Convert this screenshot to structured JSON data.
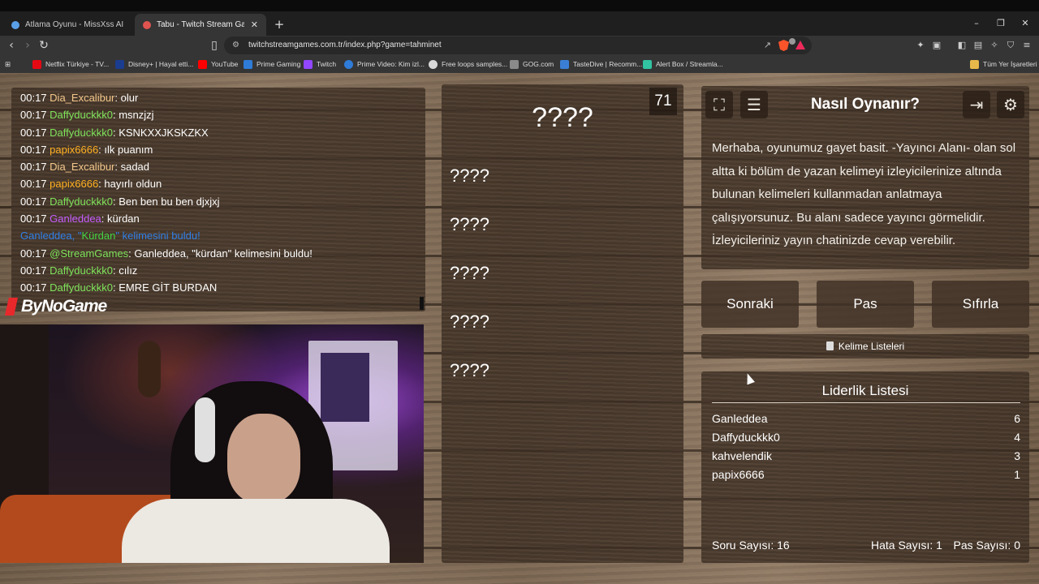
{
  "browser": {
    "tabs": [
      {
        "title": "Atlama Oyunu - MissXss AI Bot Syste",
        "active": false,
        "color": "#5aa0e8"
      },
      {
        "title": "Tabu - Twitch Stream Games",
        "active": true,
        "color": "#e0544f"
      }
    ],
    "new_tab": "+",
    "window_controls": {
      "minimize": "–",
      "maximize": "❐",
      "close": "✕"
    },
    "url": "twitchstreamgames.com.tr/index.php?game=tahminet",
    "bookmarks": [
      {
        "label": "Netflix Türkiye - TV...",
        "color": "#e50914"
      },
      {
        "label": "Disney+ | Hayal etti...",
        "color": "#1a3d8f"
      },
      {
        "label": "YouTube",
        "color": "#ff0000"
      },
      {
        "label": "Prime Gaming",
        "color": "#2f7bd8"
      },
      {
        "label": "Twitch",
        "color": "#9146ff"
      },
      {
        "label": "Prime Video: Kim izl...",
        "color": "#2f7bd8"
      },
      {
        "label": "Free loops samples...",
        "color": "#d9d9d9"
      },
      {
        "label": "GOG.com",
        "color": "#8a8a8a"
      },
      {
        "label": "TasteDive | Recomm...",
        "color": "#3a7fd5"
      },
      {
        "label": "Alert Box / Streamla...",
        "color": "#31c3a2"
      }
    ],
    "all_bookmarks": "Tüm Yer İşaretleri"
  },
  "chat": {
    "lines": [
      {
        "time": "00:17",
        "user": "Dia_Excalibur",
        "user_color": "#f3c78a",
        "msg": ": olur"
      },
      {
        "time": "00:17",
        "user": "Daffyduckkk0",
        "user_color": "#7fe35b",
        "msg": ": msnzjzj"
      },
      {
        "time": "00:17",
        "user": "Daffyduckkk0",
        "user_color": "#7fe35b",
        "msg": ": KSNKXXJKSKZKX"
      },
      {
        "time": "00:17",
        "user": "papix6666",
        "user_color": "#ffb020",
        "msg": ": ılk puanım"
      },
      {
        "time": "00:17",
        "user": "Dia_Excalibur",
        "user_color": "#f3c78a",
        "msg": ": sadad"
      },
      {
        "time": "00:17",
        "user": "papix6666",
        "user_color": "#ffb020",
        "msg": ": hayırlı oldun"
      },
      {
        "time": "00:17",
        "user": "Daffyduckkk0",
        "user_color": "#7fe35b",
        "msg": ": Ben ben bu ben djxjxj"
      },
      {
        "time": "00:17",
        "user": "Ganleddea",
        "user_color": "#c65cff",
        "msg": ": kürdan"
      },
      {
        "time": "",
        "user": "",
        "user_color": "#2f7fe8",
        "msg": ""
      },
      {
        "time": "00:17",
        "user": "@StreamGames",
        "user_color": "#7fe35b",
        "msg": ": Ganleddea, \"kürdan\" kelimesini buldu!"
      },
      {
        "time": "00:17",
        "user": "Daffyduckkk0",
        "user_color": "#7fe35b",
        "msg": ": cılız"
      },
      {
        "time": "00:17",
        "user": "Daffyduckkk0",
        "user_color": "#7fe35b",
        "msg": ": EMRE GİT BURDAN"
      }
    ],
    "announce": {
      "pre": "Ganleddea, \"",
      "word": "Kürdan",
      "post": "\" kelimesini buldu!",
      "color": "#2f7fe8",
      "word_color": "#42d442"
    }
  },
  "overlay_logo": "ByNoGame",
  "game": {
    "timer": "71",
    "main_word": "????",
    "taboo_words": [
      "????",
      "????",
      "????",
      "????",
      "????"
    ]
  },
  "how_to": {
    "title": "Nasıl Oynanır?",
    "body": "Merhaba, oyunumuz gayet basit. -Yayıncı Alanı- olan sol altta ki bölüm de yazan kelimeyi izleyicilerinize altında bulunan kelimeleri kullanmadan anlatmaya çalışıyorsunuz. Bu alanı sadece yayıncı görmelidir. İzleyicileriniz yayın chatinizde cevap verebilir."
  },
  "buttons": {
    "next": "Sonraki",
    "pass": "Pas",
    "reset": "Sıfırla",
    "word_lists": "Kelime Listeleri"
  },
  "leaderboard": {
    "title": "Liderlik Listesi",
    "rows": [
      {
        "name": "Ganleddea",
        "score": "6"
      },
      {
        "name": "Daffyduckkk0",
        "score": "4"
      },
      {
        "name": "kahvelendik",
        "score": "3"
      },
      {
        "name": "papix6666",
        "score": "1"
      }
    ]
  },
  "stats": {
    "questions": "Soru Sayısı: 16",
    "errors": "Hata Sayısı: 1",
    "passes": "Pas Sayısı: 0"
  }
}
